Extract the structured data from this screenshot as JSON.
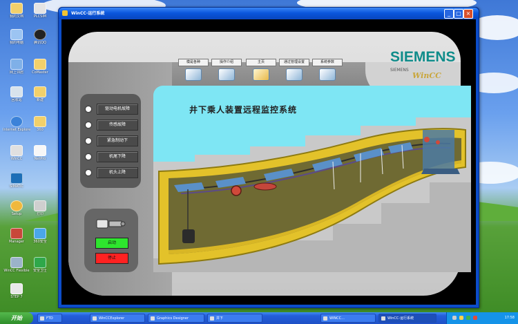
{
  "window": {
    "title": "WinCC-运行系统"
  },
  "brand": {
    "name": "SIEMENS",
    "sub": "SIEMENS",
    "product": "WinCC"
  },
  "nav": [
    {
      "label": "模是各种",
      "icon": "database-icon"
    },
    {
      "label": "操作介绍",
      "icon": "network-icon"
    },
    {
      "label": "主页",
      "icon": "folder-icon"
    },
    {
      "label": "通过管理设置",
      "icon": "monitor-icon"
    },
    {
      "label": "系统参数",
      "icon": "chart-icon"
    }
  ],
  "menu": [
    {
      "label": "驱动电机故障"
    },
    {
      "label": "传感故障"
    },
    {
      "label": "紧急制动下"
    },
    {
      "label": "机尾下降"
    },
    {
      "label": "机头上降"
    }
  ],
  "control": {
    "start": "启动",
    "stop": "停止"
  },
  "scene": {
    "title": "井下乘人装置远程监控系统"
  },
  "desktop": [
    {
      "label": "我的文档"
    },
    {
      "label": "我的电脑"
    },
    {
      "label": "网上邻居"
    },
    {
      "label": "回收站"
    },
    {
      "label": "Internet Explorer"
    },
    {
      "label": "WinCC"
    },
    {
      "label": "SIMATIC"
    },
    {
      "label": "Setup"
    },
    {
      "label": "Manager"
    },
    {
      "label": "WinCC Flexible"
    },
    {
      "label": "STEP 7"
    },
    {
      "label": "PLCSIM"
    },
    {
      "label": "腾讯QQ"
    },
    {
      "label": "CoMaster"
    },
    {
      "label": "新建"
    },
    {
      "label": "360"
    },
    {
      "label": "NetPro"
    },
    {
      "label": "打印"
    },
    {
      "label": "360安全"
    },
    {
      "label": "安全卫士"
    }
  ],
  "taskbar": {
    "start": "开始",
    "tasks": [
      "FTD",
      "WinCCExplorer",
      "Graphics Designer",
      "井下",
      "WINCC...",
      "WinCC-运行系统"
    ],
    "clock": "17:58"
  },
  "colors": {
    "accent": "#0f8c8a",
    "start_button": "#2ee52e",
    "stop_button": "#ff2222"
  }
}
